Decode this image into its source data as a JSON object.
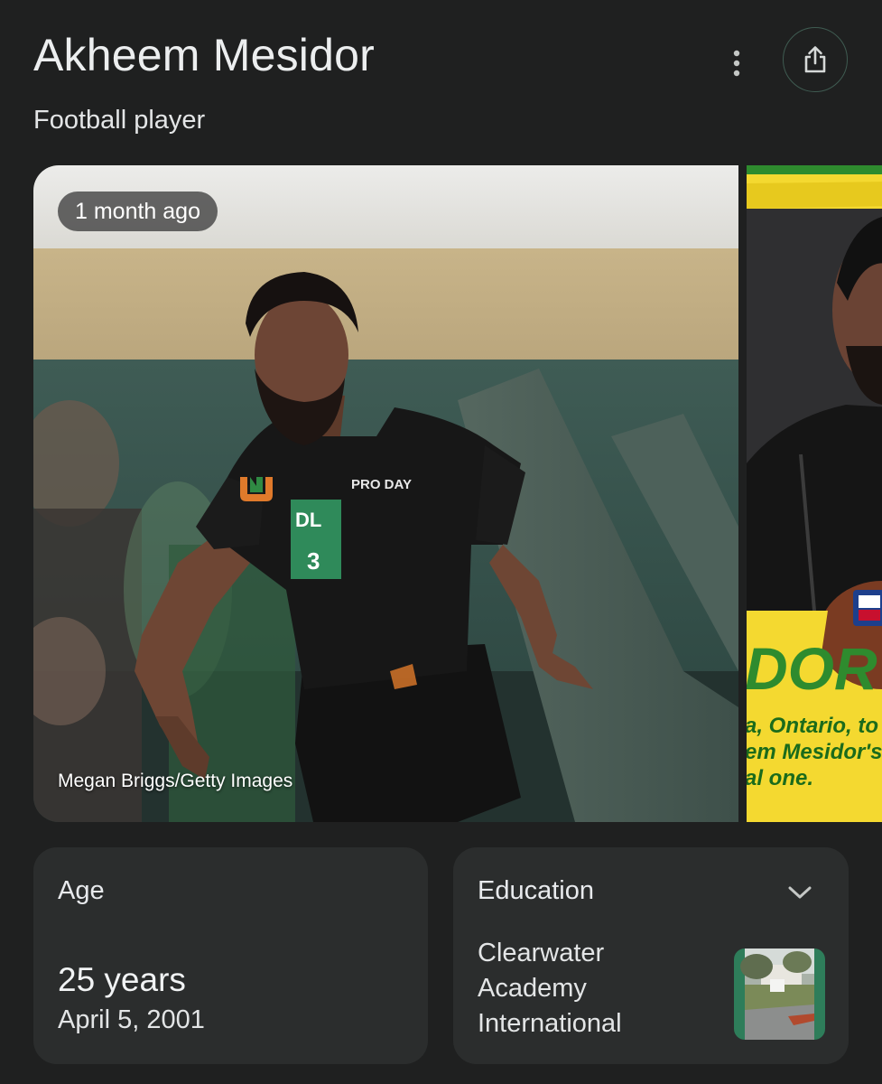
{
  "header": {
    "title": "Akheem Mesidor",
    "subtitle": "Football player"
  },
  "carousel": {
    "items": [
      {
        "badge": "1 month ago",
        "credit": "Megan Briggs/Getty Images",
        "jersey_text": "DL",
        "jersey_number": "3",
        "chest_text": "PRO DAY"
      },
      {
        "headline_fragment": "DOR",
        "caption_lines": [
          "a, Ontario, to t",
          "em Mesidor's",
          "al one."
        ]
      }
    ]
  },
  "facts": {
    "age": {
      "label": "Age",
      "value": "25 years",
      "date": "April 5, 2001"
    },
    "education": {
      "label": "Education",
      "school": "Clearwater Academy International"
    }
  },
  "colors": {
    "background": "#1f2020",
    "card": "#2b2d2d",
    "share_border": "#3f5b51",
    "banner_yellow": "#f4d930",
    "banner_green": "#2e8b2e"
  }
}
